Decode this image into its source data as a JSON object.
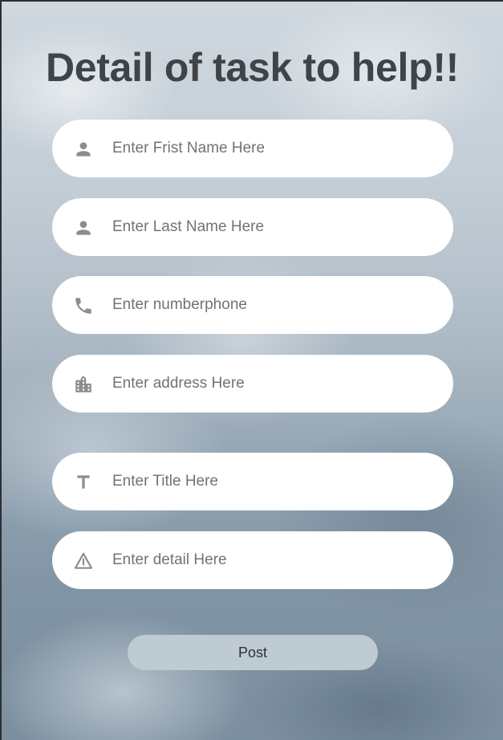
{
  "page": {
    "title": "Detail of task to help!!"
  },
  "form": {
    "fields": [
      {
        "name": "first-name",
        "icon": "person-icon",
        "placeholder": "Enter Frist Name Here"
      },
      {
        "name": "last-name",
        "icon": "person-icon",
        "placeholder": "Enter Last Name Here"
      },
      {
        "name": "phone",
        "icon": "phone-icon",
        "placeholder": "Enter numberphone"
      },
      {
        "name": "address",
        "icon": "building-icon",
        "placeholder": "Enter address Here"
      },
      {
        "name": "title",
        "icon": "text-icon",
        "placeholder": "Enter Title Here"
      },
      {
        "name": "detail",
        "icon": "warning-triangle-icon",
        "placeholder": "Enter detail Here"
      }
    ],
    "submit_label": "Post"
  },
  "colors": {
    "title_text": "#3f4448",
    "field_background": "#ffffff",
    "icon": "#8a8e91",
    "placeholder": "#6f7376",
    "button_background": "#bfcbd3",
    "button_text": "#2d3134"
  }
}
